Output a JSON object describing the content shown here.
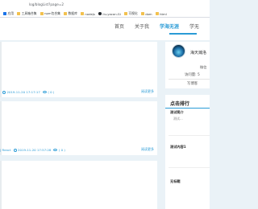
{
  "browser": {
    "address": "log/blogList?page=2",
    "bookmarks": [
      {
        "icon": "apps-icon",
        "label": "应用"
      },
      {
        "icon": "folder-icon",
        "label": "工具箱合集"
      },
      {
        "icon": "folder-icon",
        "label": "npm包合集"
      },
      {
        "icon": "folder-icon",
        "label": "数据库"
      },
      {
        "icon": "folder-icon",
        "label": "nodejs"
      },
      {
        "icon": "github-icon",
        "label": "liu-yacon.Gi"
      },
      {
        "icon": "folder-icon",
        "label": "可视化"
      },
      {
        "icon": "folder-icon",
        "label": "dom"
      },
      {
        "icon": "folder-icon",
        "label": "html"
      }
    ]
  },
  "nav": {
    "items": [
      "首页",
      "关于我",
      "学海无涯",
      "学无"
    ],
    "active_index": 2
  },
  "posts": [
    {
      "meta_prefix": "",
      "date": "2019-11-20 17:17:17",
      "views": "( 0 )",
      "read_more": "阅读更多"
    },
    {
      "meta_prefix": "| React",
      "date": "2019-11-20 17:57:28",
      "views": "( 0 )",
      "read_more": "阅读更多"
    }
  ],
  "profile": {
    "name": "海天瀚洛",
    "follow": "微信",
    "visits": "访问量: 5",
    "posts": "写博客"
  },
  "ranking": {
    "title": "点击排行",
    "items": [
      {
        "title": "测试简介",
        "sub": "测试..."
      },
      {
        "title": "测试内容1",
        "sub": ""
      },
      {
        "title": "无标题",
        "sub": ""
      }
    ]
  }
}
